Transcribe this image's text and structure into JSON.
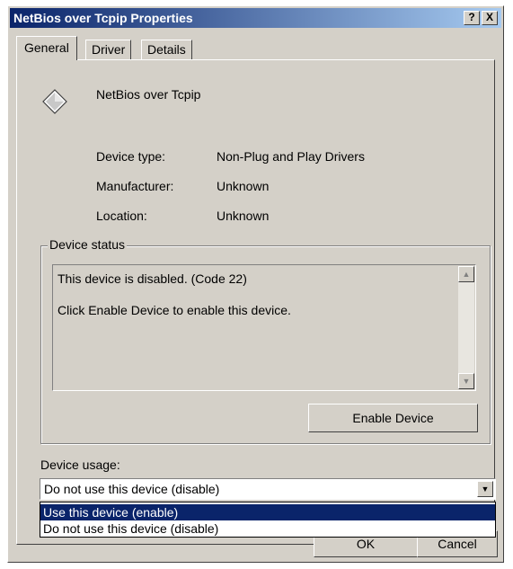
{
  "window": {
    "title": "NetBios over Tcpip Properties",
    "help_button": "?",
    "close_button": "X"
  },
  "tabs": [
    {
      "label": "General",
      "active": true
    },
    {
      "label": "Driver",
      "active": false
    },
    {
      "label": "Details",
      "active": false
    }
  ],
  "device": {
    "icon": "diamond-device-icon",
    "name": "NetBios over Tcpip",
    "properties": [
      {
        "label": "Device type:",
        "value": "Non-Plug and Play Drivers"
      },
      {
        "label": "Manufacturer:",
        "value": "Unknown"
      },
      {
        "label": "Location:",
        "value": "Unknown"
      }
    ]
  },
  "device_status": {
    "legend": "Device status",
    "lines": [
      "This device is disabled. (Code 22)",
      "Click Enable Device to enable this device."
    ],
    "enable_button": "Enable Device"
  },
  "device_usage": {
    "label": "Device usage:",
    "selected": "Do not use this device (disable)",
    "options": [
      "Use this device (enable)",
      "Do not use this device (disable)"
    ],
    "highlighted_index": 0
  },
  "footer": {
    "ok_label": "OK",
    "cancel_label": "Cancel"
  },
  "colors": {
    "titlebar_start": "#0a246a",
    "titlebar_end": "#a6caf0",
    "face": "#d4d0c8",
    "highlight": "#0a246a"
  }
}
